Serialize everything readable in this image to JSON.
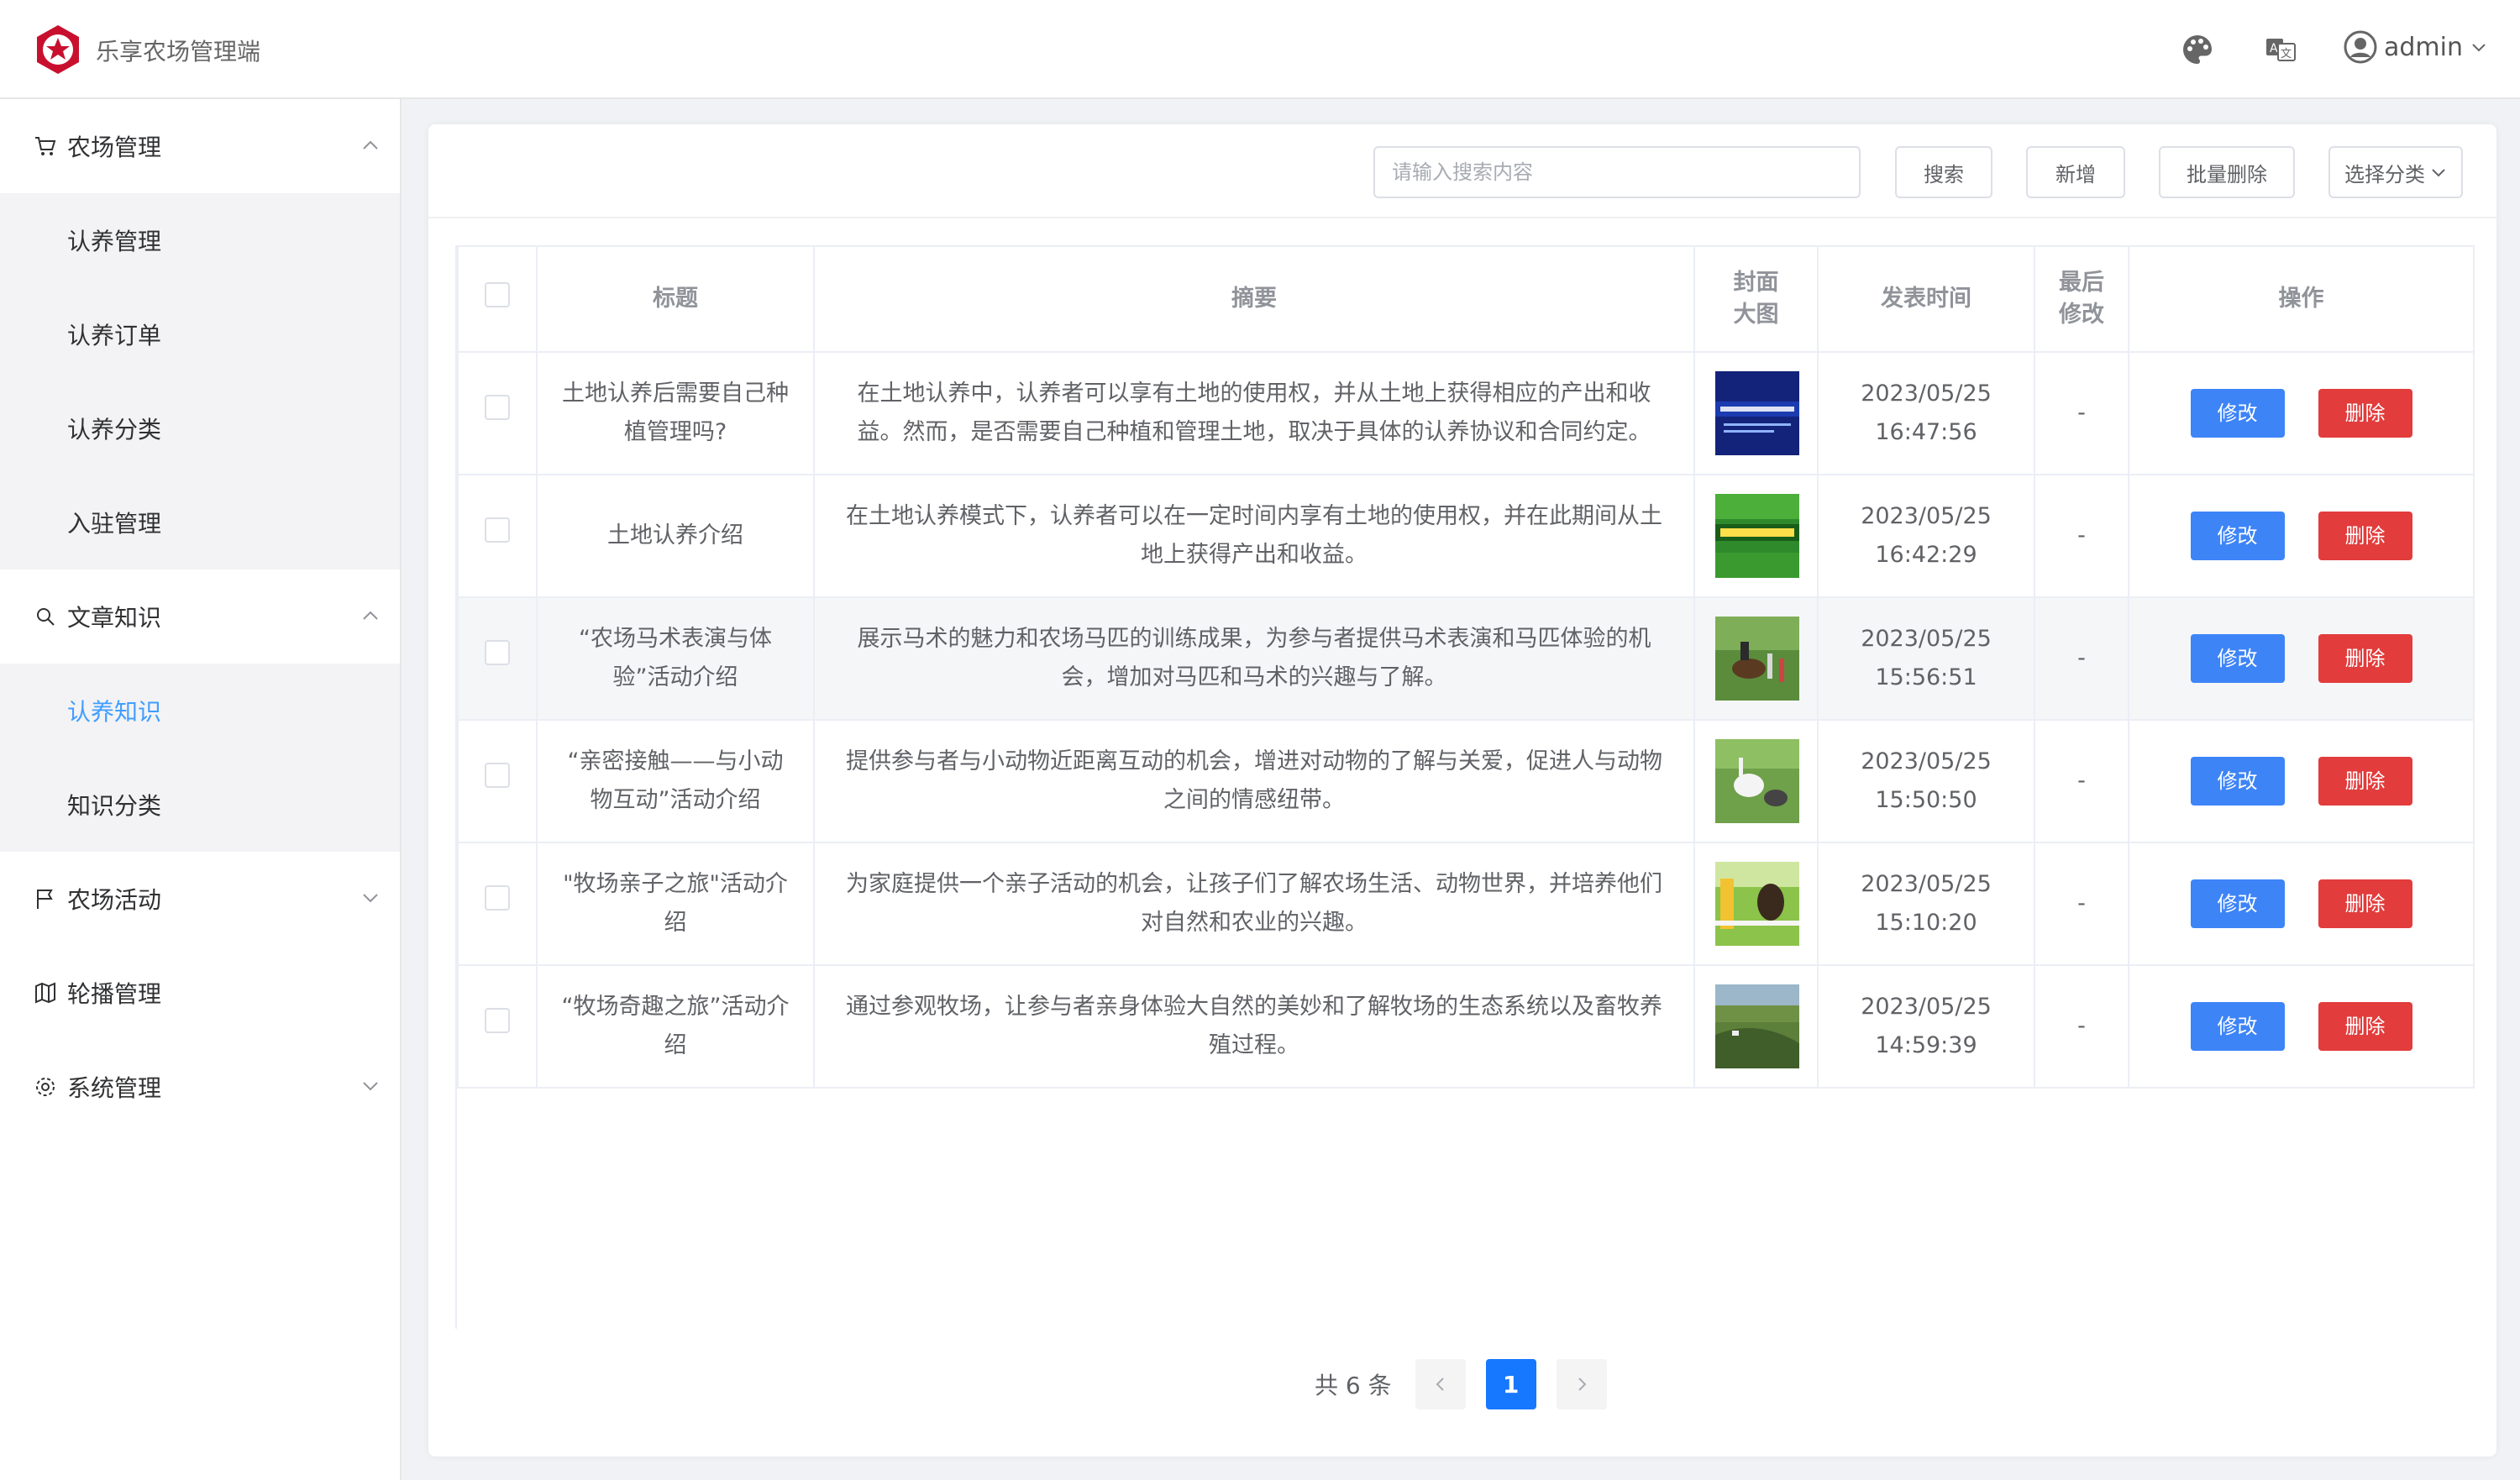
{
  "header": {
    "app_title": "乐享农场管理端",
    "username": "admin"
  },
  "sidebar": {
    "groups": [
      {
        "label": "农场管理",
        "icon": "cart-icon",
        "expanded": true,
        "items": [
          "认养管理",
          "认养订单",
          "认养分类",
          "入驻管理"
        ]
      },
      {
        "label": "文章知识",
        "icon": "search-icon",
        "expanded": true,
        "items": [
          "认养知识",
          "知识分类"
        ],
        "active_item": "认养知识"
      },
      {
        "label": "农场活动",
        "icon": "flag-icon",
        "expanded": false,
        "items": []
      },
      {
        "label": "轮播管理",
        "icon": "map-icon",
        "expanded": false,
        "items": []
      },
      {
        "label": "系统管理",
        "icon": "gear-icon",
        "expanded": false,
        "items": []
      }
    ]
  },
  "toolbar": {
    "search_placeholder": "请输入搜索内容",
    "search_label": "搜索",
    "add_label": "新增",
    "batch_delete_label": "批量删除",
    "category_select": "选择分类"
  },
  "table": {
    "headers": [
      "标题",
      "摘要",
      "封面大图",
      "发表时间",
      "最后修改",
      "操作"
    ],
    "rows": [
      {
        "title": "土地认养后需要自己种植管理吗?",
        "summary": "在土地认养中，认养者可以享有土地的使用权，并从土地上获得相应的产出和收益。然而，是否需要自己种植和管理土地，取决于具体的认养协议和合同约定。",
        "date": "2023/05/25",
        "time": "16:47:56",
        "modified": "-"
      },
      {
        "title": "土地认养介绍",
        "summary": "在土地认养模式下，认养者可以在一定时间内享有土地的使用权，并在此期间从土地上获得产出和收益。",
        "date": "2023/05/25",
        "time": "16:42:29",
        "modified": "-"
      },
      {
        "title": "“农场马术表演与体验”活动介绍",
        "summary": "展示马术的魅力和农场马匹的训练成果，为参与者提供马术表演和马匹体验的机会，增加对马匹和马术的兴趣与了解。",
        "date": "2023/05/25",
        "time": "15:56:51",
        "modified": "-"
      },
      {
        "title": "“亲密接触——与小动物互动”活动介绍",
        "summary": "提供参与者与小动物近距离互动的机会，增进对动物的了解与关爱，促进人与动物之间的情感纽带。",
        "date": "2023/05/25",
        "time": "15:50:50",
        "modified": "-"
      },
      {
        "title": "\"牧场亲子之旅\"活动介绍",
        "summary": "为家庭提供一个亲子活动的机会，让孩子们了解农场生活、动物世界，并培养他们对自然和农业的兴趣。",
        "date": "2023/05/25",
        "time": "15:10:20",
        "modified": "-"
      },
      {
        "title": "“牧场奇趣之旅”活动介绍",
        "summary": "通过参观牧场，让参与者亲身体验大自然的美妙和了解牧场的生态系统以及畜牧养殖过程。",
        "date": "2023/05/25",
        "time": "14:59:39",
        "modified": "-"
      }
    ],
    "edit_label": "修改",
    "delete_label": "删除"
  },
  "pagination": {
    "total_text": "共 6 条",
    "current_page": "1"
  },
  "colors": {
    "primary": "#409eff",
    "edit_button": "#3d84f7",
    "delete_button": "#e23c3c",
    "logo_red": "#c8102e"
  }
}
